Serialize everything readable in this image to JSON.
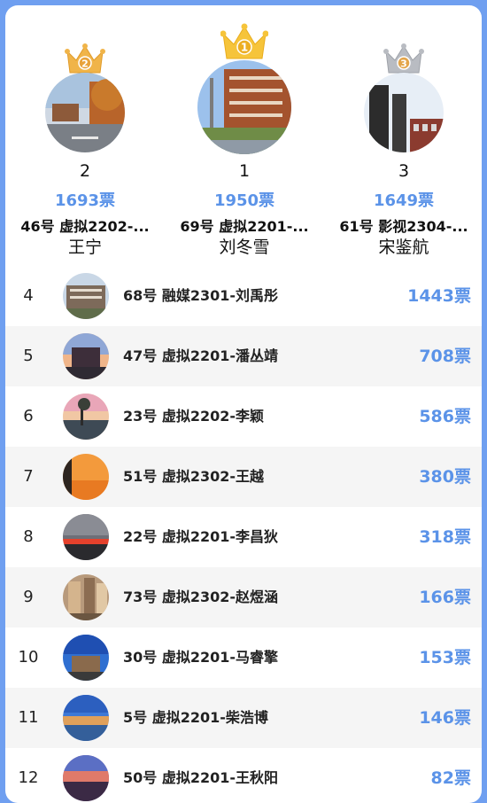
{
  "podium": {
    "second": {
      "badge": "2",
      "rank": "2",
      "votes": "1693票",
      "info": "46号 虚拟2202-...",
      "name": "王宁"
    },
    "first": {
      "badge": "1",
      "rank": "1",
      "votes": "1950票",
      "info": "69号 虚拟2201-...",
      "name": "刘冬雪"
    },
    "third": {
      "badge": "3",
      "rank": "3",
      "votes": "1649票",
      "info": "61号 影视2304-...",
      "name": "宋鉴航"
    }
  },
  "list": [
    {
      "rank": "4",
      "info": "68号 融媒2301-刘禹彤",
      "votes": "1443票"
    },
    {
      "rank": "5",
      "info": "47号 虚拟2201-潘丛靖",
      "votes": "708票"
    },
    {
      "rank": "6",
      "info": "23号 虚拟2202-李颖",
      "votes": "586票"
    },
    {
      "rank": "7",
      "info": "51号 虚拟2302-王越",
      "votes": "380票"
    },
    {
      "rank": "8",
      "info": "22号 虚拟2201-李昌狄",
      "votes": "318票"
    },
    {
      "rank": "9",
      "info": "73号 虚拟2302-赵煜涵",
      "votes": "166票"
    },
    {
      "rank": "10",
      "info": "30号 虚拟2201-马睿擎",
      "votes": "153票"
    },
    {
      "rank": "11",
      "info": "5号 虚拟2201-柴浩博",
      "votes": "146票"
    },
    {
      "rank": "12",
      "info": "50号 虚拟2201-王秋阳",
      "votes": "82票"
    }
  ],
  "colors": {
    "page_bg": "#6f9ff0",
    "accent": "#5b93e8",
    "gold": "#f6c43a",
    "bronze": "#f0b449",
    "silver": "#b9bcc2"
  },
  "icons": [
    "crown-icon"
  ]
}
